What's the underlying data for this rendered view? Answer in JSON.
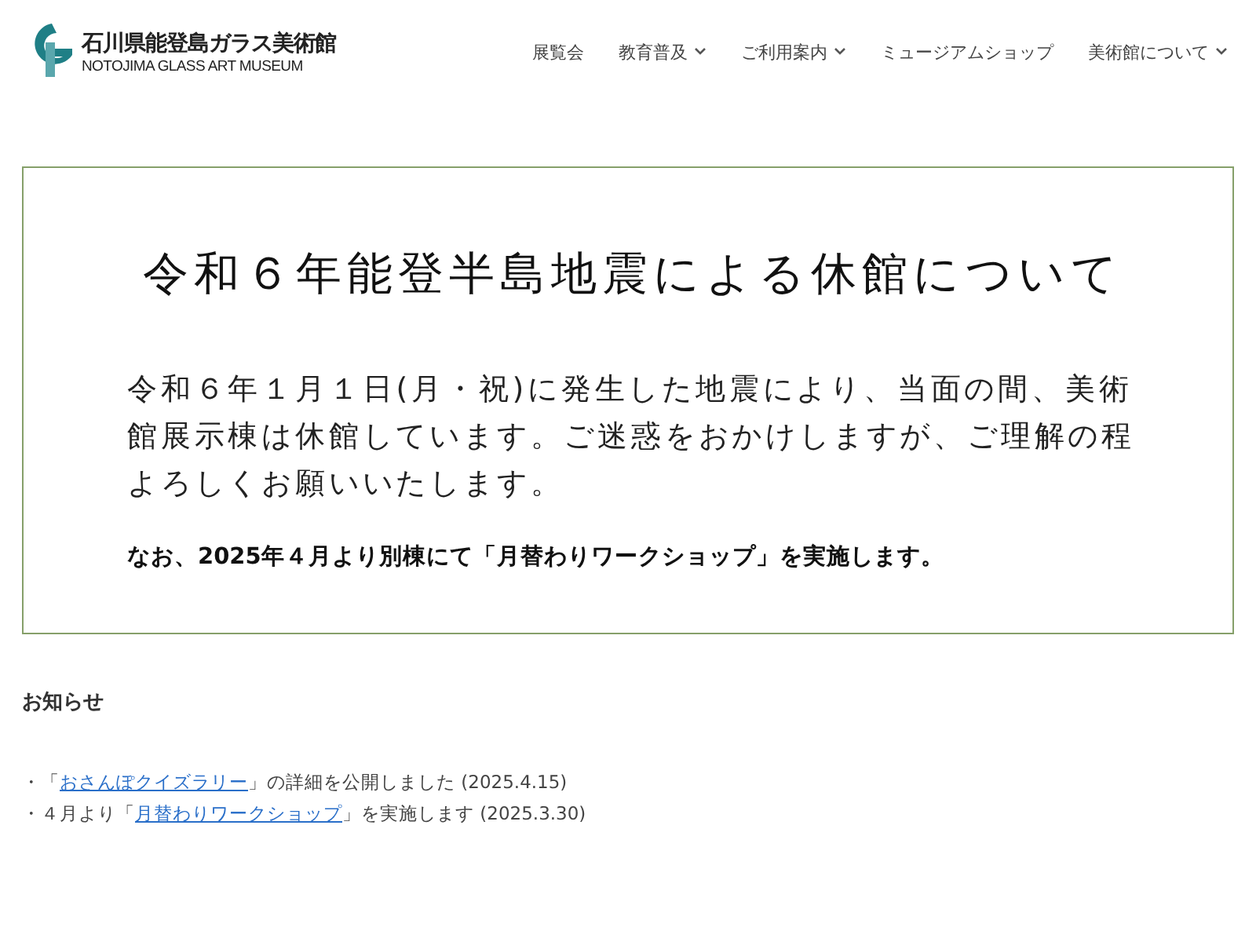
{
  "header": {
    "logo_title": "石川県能登島ガラス美術館",
    "logo_subtitle": "NOTOJIMA GLASS ART MUSEUM",
    "nav": [
      {
        "label": "展覧会",
        "dropdown": false
      },
      {
        "label": "教育普及",
        "dropdown": true
      },
      {
        "label": "ご利用案内",
        "dropdown": true
      },
      {
        "label": "ミュージアムショップ",
        "dropdown": false
      },
      {
        "label": "美術館について",
        "dropdown": true
      }
    ]
  },
  "notice": {
    "title": "令和６年能登半島地震による休館について",
    "body": "令和６年１月１日(月・祝)に発生した地震により、当面の間、美術館展示棟は休館しています。ご迷惑をおかけしますが、ご理解の程よろしくお願いいたします。",
    "note": "なお、2025年４月より別棟にて「月替わりワークショップ」を実施します。"
  },
  "news": {
    "heading": "お知らせ",
    "items": [
      {
        "prefix": "・「",
        "link": "おさんぽクイズラリー",
        "suffix": "」の詳細を公開しました (2025.4.15)"
      },
      {
        "prefix": "・４月より「",
        "link": "月替わりワークショップ",
        "suffix": "」を実施します (2025.3.30)"
      }
    ]
  }
}
